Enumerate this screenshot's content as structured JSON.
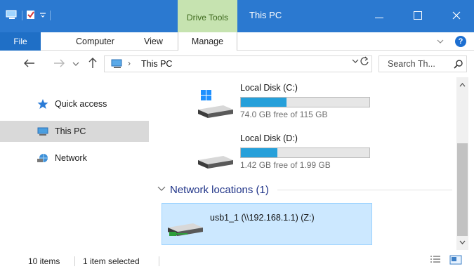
{
  "window": {
    "title": "This PC",
    "context_group": "Drive Tools",
    "icons": {
      "app": "this-pc-icon",
      "quick_properties": "properties-icon",
      "qat_dropdown": "dropdown-icon",
      "minimize": "minimize-icon",
      "maximize": "maximize-icon",
      "close": "close-icon"
    }
  },
  "ribbon": {
    "tabs": [
      {
        "label": "File",
        "active": true
      },
      {
        "label": "Computer"
      },
      {
        "label": "View"
      },
      {
        "label": "Manage"
      }
    ],
    "help_label": "?",
    "colors": {
      "file_tab": "#1f6fc6",
      "context_tab": "#c6e3b0",
      "titlebar": "#2b79d0"
    }
  },
  "address": {
    "path": "This PC",
    "separator": "›",
    "search_placeholder": "Search Th...",
    "icons": {
      "back": "back-arrow-icon",
      "forward": "forward-arrow-icon",
      "recent": "recent-locations-icon",
      "up": "up-arrow-icon",
      "refresh": "refresh-icon",
      "search": "search-icon"
    }
  },
  "nav": {
    "items": [
      {
        "label": "Quick access",
        "icon": "star-icon"
      },
      {
        "label": "This PC",
        "icon": "computer-icon",
        "selected": true
      },
      {
        "label": "Network",
        "icon": "network-icon"
      }
    ]
  },
  "drives": [
    {
      "name": "Local Disk (C:)",
      "free_text": "74.0 GB free of 115 GB",
      "used_fraction": 0.357,
      "icon": "windows-drive-icon"
    },
    {
      "name": "Local Disk (D:)",
      "free_text": "1.42 GB free of 1.99 GB",
      "used_fraction": 0.286,
      "icon": "drive-icon"
    }
  ],
  "network_group": {
    "title": "Network locations (1)",
    "items": [
      {
        "name": "usb1_1 (\\\\192.168.1.1) (Z:)",
        "icon": "network-drive-icon",
        "selected": true
      }
    ]
  },
  "status": {
    "count": "10 items",
    "selection": "1 item selected"
  },
  "accent": {
    "bar_fill": "#26a0da",
    "selection_bg": "#cce8ff",
    "group_title": "#1e3287"
  }
}
